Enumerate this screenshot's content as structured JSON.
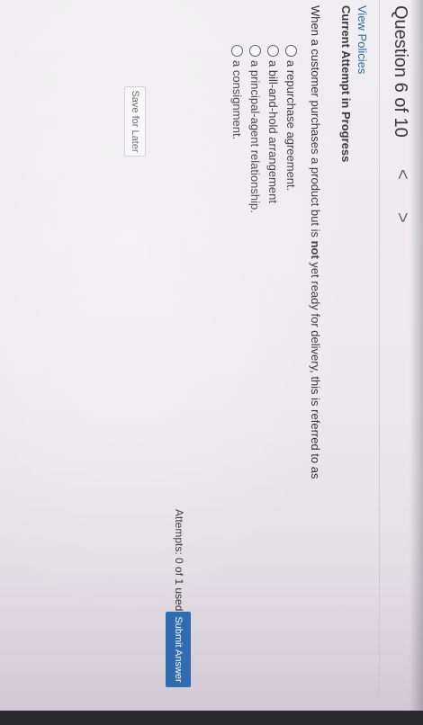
{
  "header": {
    "question_counter": "Question 6 of 10",
    "prev_glyph": "<",
    "next_glyph": ">"
  },
  "links": {
    "view_policies": "View Policies"
  },
  "attempt": {
    "status_heading": "Current Attempt in Progress",
    "attempts_label": "Attempts: 0 of 1 used"
  },
  "question": {
    "text_before": "When a customer purchases a product but is ",
    "text_bold": "not",
    "text_after": " yet ready for delivery, this is referred to as",
    "options": [
      {
        "label": "a repurchase agreement."
      },
      {
        "label": "a bill-and-hold arrangement"
      },
      {
        "label": "a principal-agent relationship."
      },
      {
        "label": "a consignment."
      }
    ]
  },
  "buttons": {
    "save_for_later": "Save for Later",
    "submit_answer": "Submit Answer"
  },
  "colors": {
    "link": "#2a6aa5",
    "submit_bg": "#2b6cb1"
  }
}
